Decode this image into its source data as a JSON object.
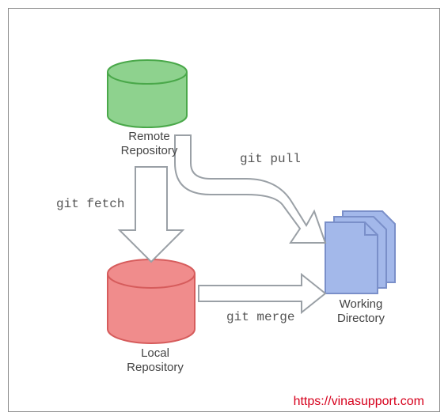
{
  "remote": {
    "label_line1": "Remote",
    "label_line2": "Repository",
    "fill": "#8ed28e",
    "stroke": "#4aa84a"
  },
  "local": {
    "label_line1": "Local",
    "label_line2": "Repository",
    "fill": "#f08c8c",
    "stroke": "#d65c5c"
  },
  "working": {
    "label_line1": "Working",
    "label_line2": "Directory",
    "fill": "#a3b8ea",
    "stroke": "#7a8fc9"
  },
  "commands": {
    "fetch": "git fetch",
    "pull": "git pull",
    "merge": "git merge"
  },
  "attribution": "https://vinasupport.com",
  "arrow": {
    "fill": "#ffffff",
    "stroke": "#9aa0a6"
  }
}
